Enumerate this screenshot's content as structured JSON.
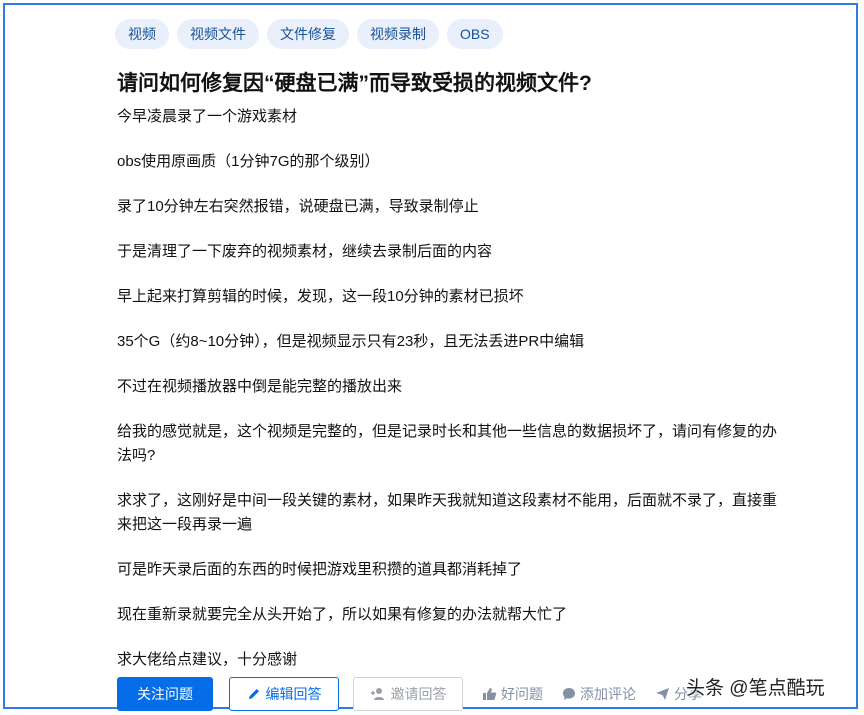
{
  "tags": [
    "视频",
    "视频文件",
    "文件修复",
    "视频录制",
    "OBS"
  ],
  "question": {
    "title": "请问如何修复因“硬盘已满”而导致受损的视频文件?",
    "paragraphs": [
      "今早凌晨录了一个游戏素材",
      "obs使用原画质（1分钟7G的那个级别）",
      "录了10分钟左右突然报错，说硬盘已满，导致录制停止",
      "于是清理了一下废弃的视频素材，继续去录制后面的内容",
      "早上起来打算剪辑的时候，发现，这一段10分钟的素材已损坏",
      "35个G（约8~10分钟），但是视频显示只有23秒，且无法丢进PR中编辑",
      "不过在视频播放器中倒是能完整的播放出来",
      "给我的感觉就是，这个视频是完整的，但是记录时长和其他一些信息的数据损坏了，请问有修复的办法吗?",
      "求求了，这刚好是中间一段关键的素材，如果昨天我就知道这段素材不能用，后面就不录了，直接重来把这一段再录一遍",
      "可是昨天录后面的东西的时候把游戏里积攒的道具都消耗掉了",
      "现在重新录就要完全从头开始了，所以如果有修复的办法就帮大忙了",
      "求大佬给点建议，十分感谢"
    ]
  },
  "actions": {
    "follow": "关注问题",
    "edit_answer": "编辑回答",
    "invite_answer": "邀请回答",
    "good_question": "好问题",
    "add_comment": "添加评论",
    "share": "分享"
  },
  "watermark": "头条 @笔点酷玩",
  "colors": {
    "accent": "#056de8",
    "tag_bg": "#eaf0fb",
    "tag_text": "#175199",
    "meta": "#8590a6"
  }
}
